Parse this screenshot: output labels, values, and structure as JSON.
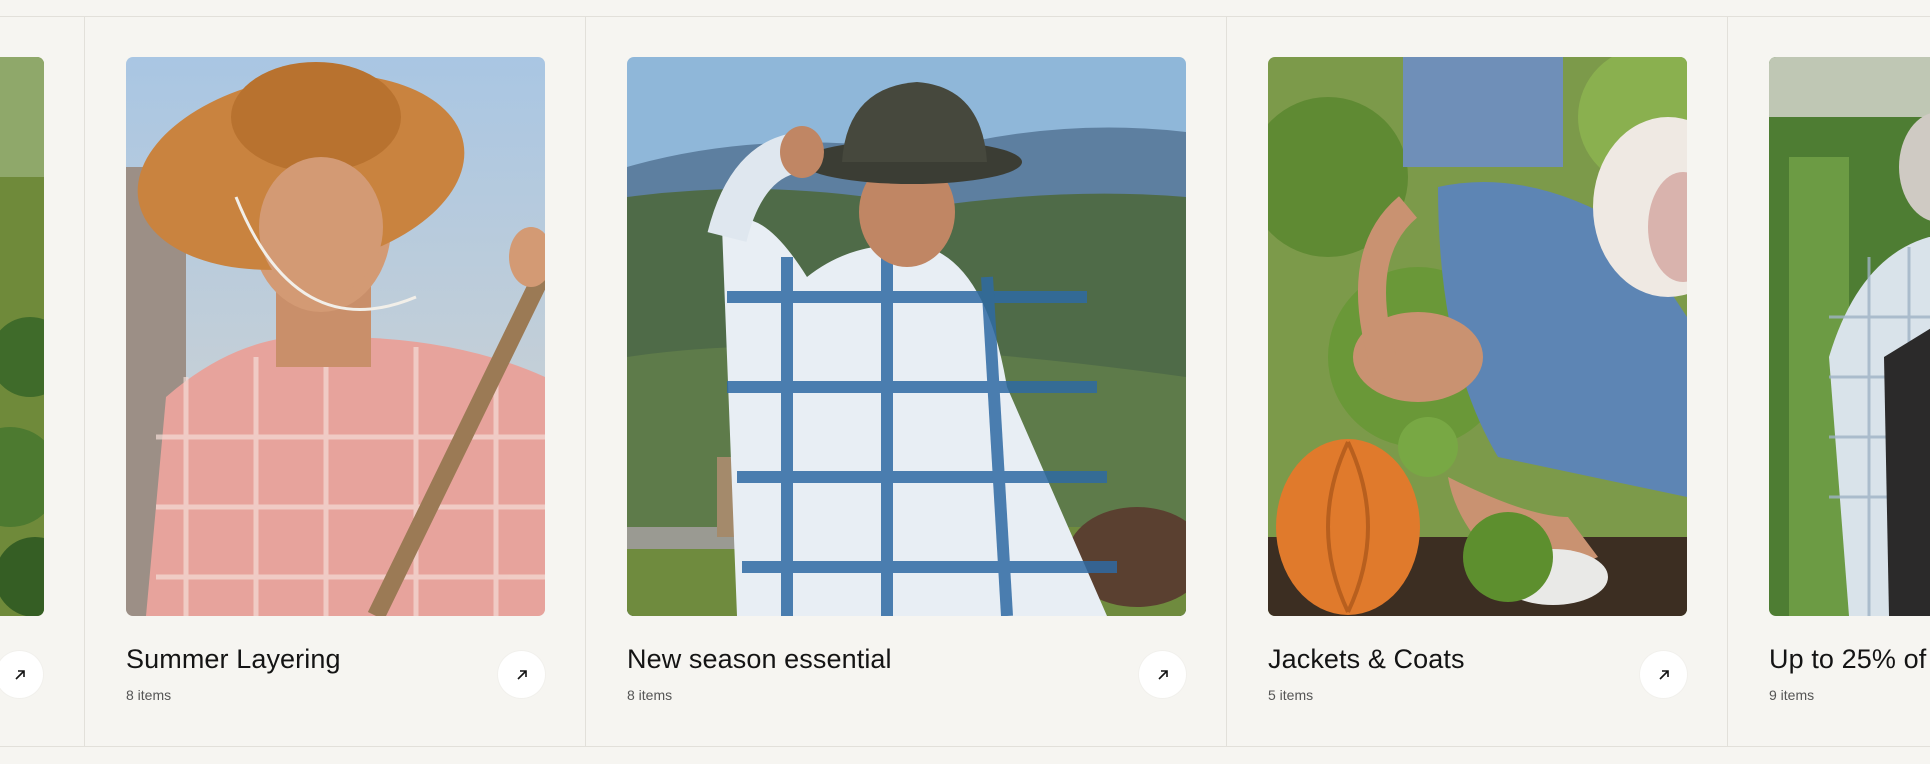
{
  "collections": [
    {
      "title": "",
      "count": ""
    },
    {
      "title": "Summer Layering",
      "count": "8 items"
    },
    {
      "title": "New season essential",
      "count": "8 items"
    },
    {
      "title": "Jackets & Coats",
      "count": "5 items"
    },
    {
      "title": "Up to 25% of",
      "count": "9 items"
    }
  ],
  "icons": {
    "link": "arrow-up-right-icon"
  },
  "colors": {
    "background": "#f6f5f1",
    "divider": "#e2e0da",
    "text": "#141414",
    "muted": "#555555"
  }
}
